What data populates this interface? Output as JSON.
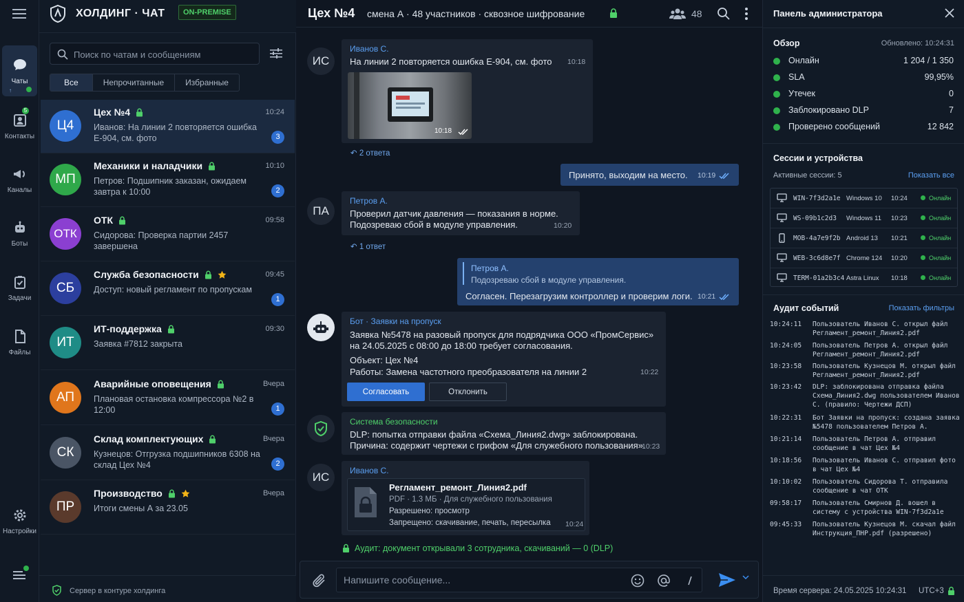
{
  "app": {
    "title": "ХОЛДИНГ · ЧАТ",
    "mode_badge": "ON-PREMISE"
  },
  "rail": {
    "items": [
      {
        "label": "Чаты",
        "icon": "chat-bubble-icon"
      },
      {
        "label": "Контакты",
        "icon": "contacts-icon",
        "badge": "5"
      },
      {
        "label": "Каналы",
        "icon": "megaphone-icon"
      },
      {
        "label": "Боты",
        "icon": "bot-icon"
      },
      {
        "label": "Задачи",
        "icon": "tasks-icon"
      },
      {
        "label": "Файлы",
        "icon": "file-icon"
      },
      {
        "label": "Настройки",
        "icon": "gear-icon"
      }
    ]
  },
  "search": {
    "placeholder": "Поиск по чатам и сообщениям"
  },
  "filters": [
    "Все",
    "Непрочитанные",
    "Избранные"
  ],
  "chats": [
    {
      "initials": "Ц4",
      "color": "#2f6fd1",
      "name": "Цех №4",
      "time": "10:24",
      "preview": "Иванов: На линии 2 повторяется ошибка E-904, см. фото",
      "unread": "3",
      "lock": true,
      "star": false,
      "active": true
    },
    {
      "initials": "МП",
      "color": "#2fa84a",
      "name": "Механики и наладчики",
      "time": "10:10",
      "preview": "Петров: Подшипник заказан, ожидаем завтра к 10:00",
      "unread": "2",
      "lock": true,
      "star": false
    },
    {
      "initials": "ОТК",
      "color": "#8b3fd1",
      "name": "ОТК",
      "time": "09:58",
      "preview": "Сидорова: Проверка партии 2457 завершена",
      "unread": "",
      "lock": true,
      "star": false
    },
    {
      "initials": "СБ",
      "color": "#2c3f9e",
      "name": "Служба безопасности",
      "time": "09:45",
      "preview": "Доступ: новый регламент по пропускам",
      "unread": "1",
      "lock": true,
      "star": true
    },
    {
      "initials": "ИТ",
      "color": "#1f8c86",
      "name": "ИТ-поддержка",
      "time": "09:30",
      "preview": "Заявка #7812 закрыта",
      "unread": "",
      "lock": true,
      "star": false
    },
    {
      "initials": "АП",
      "color": "#e0761c",
      "name": "Аварийные оповещения",
      "time": "Вчера",
      "preview": "Плановая остановка компрессора №2 в 12:00",
      "unread": "1",
      "lock": true,
      "star": false
    },
    {
      "initials": "СК",
      "color": "#4a5565",
      "name": "Склад комплектующих",
      "time": "Вчера",
      "preview": "Кузнецов: Отгрузка подшипников 6308 на склад Цех №4",
      "unread": "2",
      "lock": true,
      "star": false
    },
    {
      "initials": "ПР",
      "color": "#5a3a2c",
      "name": "Производство",
      "time": "Вчера",
      "preview": "Итоги смены А за 23.05",
      "unread": "",
      "lock": true,
      "star": true
    }
  ],
  "list_footer": "Сервер в контуре холдинга",
  "chat": {
    "title": "Цех №4",
    "subtitle": "смена А · 48 участников · сквозное шифрование",
    "members_count": "48",
    "messages": {
      "m1": {
        "avatar": "ИС",
        "author": "Иванов С.",
        "text": "На линии 2 повторяется ошибка E-904, см. фото",
        "time": "10:18",
        "photo_time": "10:18",
        "replies": "2 ответа"
      },
      "m2": {
        "text": "Принято, выходим на место.",
        "time": "10:19"
      },
      "m3": {
        "avatar": "ПА",
        "author": "Петров А.",
        "line1": "Проверил датчик давления — показания в норме.",
        "line2": "Подозреваю сбой в модуле управления.",
        "time": "10:20",
        "replies": "1 ответ"
      },
      "m4": {
        "quote_author": "Петров А.",
        "quote_text": "Подозреваю сбой в модуле управления.",
        "text": "Согласен. Перезагрузим контроллер и проверим логи.",
        "time": "10:21"
      },
      "m5": {
        "author": "Бот · Заявки на пропуск",
        "line1": "Заявка №5478 на разовый пропуск для подрядчика ООО «ПромСервис»",
        "line2": "на 24.05.2025 с 08:00 до 18:00 требует согласования.",
        "line3": "Объект: Цех №4",
        "line4": "Работы: Замена частотного преобразователя на линии 2",
        "time": "10:22",
        "approve": "Согласовать",
        "reject": "Отклонить"
      },
      "m6": {
        "author": "Система безопасности",
        "line1": "DLP: попытка отправки файла «Схема_Линия2.dwg» заблокирована.",
        "line2": "Причина: содержит чертежи с грифом «Для служебного пользования».",
        "time": "10:23"
      },
      "m7": {
        "avatar": "ИС",
        "author": "Иванов С.",
        "file_name": "Регламент_ремонт_Линия2.pdf",
        "file_meta": "PDF · 1.3 МБ · Для служебного пользования",
        "allowed": "Разрешено: просмотр",
        "denied": "Запрещено: скачивание, печать, пересылка",
        "time": "10:24"
      }
    },
    "audit_note": "Аудит: документ открывали 3 сотрудника, скачиваний — 0 (DLP)"
  },
  "composer": {
    "placeholder": "Напишите сообщение..."
  },
  "admin": {
    "title": "Панель администратора",
    "overview": {
      "title": "Обзор",
      "updated": "Обновлено: 10:24:31",
      "rows": [
        {
          "label": "Онлайн",
          "value": "1 204 / 1 350"
        },
        {
          "label": "SLA",
          "value": "99,95%"
        },
        {
          "label": "Утечек",
          "value": "0"
        },
        {
          "label": "Заблокировано DLP",
          "value": "7"
        },
        {
          "label": "Проверено сообщений",
          "value": "12 842"
        }
      ]
    },
    "sessions": {
      "title": "Сессии и устройства",
      "active": "Активные сессии: 5",
      "show_all": "Показать все",
      "rows": [
        {
          "device": "WIN-7f3d2a1e",
          "os": "Windows 10",
          "time": "10:24",
          "status": "Онлайн",
          "icon": "monitor-icon"
        },
        {
          "device": "WS-09b1c2d3",
          "os": "Windows 11",
          "time": "10:23",
          "status": "Онлайн",
          "icon": "monitor-icon"
        },
        {
          "device": "MOB-4a7e9f2b",
          "os": "Android 13",
          "time": "10:21",
          "status": "Онлайн",
          "icon": "phone-icon"
        },
        {
          "device": "WEB-3c6d8e7f",
          "os": "Chrome 124",
          "time": "10:20",
          "status": "Онлайн",
          "icon": "monitor-icon"
        },
        {
          "device": "TERM-01a2b3c4",
          "os": "Astra Linux",
          "time": "10:18",
          "status": "Онлайн",
          "icon": "monitor-icon"
        }
      ]
    },
    "audit": {
      "title": "Аудит событий",
      "filters_link": "Показать фильтры",
      "rows": [
        {
          "time": "10:24:11",
          "text": "Пользователь Иванов С. открыл файл Регламент_ремонт_Линия2.pdf"
        },
        {
          "time": "10:24:05",
          "text": "Пользователь Петров А. открыл файл Регламент_ремонт_Линия2.pdf"
        },
        {
          "time": "10:23:58",
          "text": "Пользователь Кузнецов М. открыл файл Регламент_ремонт_Линия2.pdf"
        },
        {
          "time": "10:23:42",
          "text": "DLP: заблокирована отправка файла Схема_Линия2.dwg пользователем Иванов С. (правило: Чертежи ДСП)"
        },
        {
          "time": "10:22:31",
          "text": "Бот Заявки на пропуск: создана заявка №5478 пользователем Петров А."
        },
        {
          "time": "10:21:14",
          "text": "Пользователь Петров А. отправил сообщение в чат Цех №4"
        },
        {
          "time": "10:18:56",
          "text": "Пользователь Иванов С. отправил фото в чат Цех №4"
        },
        {
          "time": "10:10:02",
          "text": "Пользователь Сидорова Т. отправила сообщение в чат ОТК"
        },
        {
          "time": "09:58:17",
          "text": "Пользователь Смирнов Д. вошел в систему с устройства WIN-7f3d2a1e"
        },
        {
          "time": "09:45:33",
          "text": "Пользователь Кузнецов М. скачал файл Инструкция_ПНР.pdf (разрешено)"
        }
      ]
    },
    "footer": {
      "server_time": "Время сервера: 24.05.2025 10:24:31",
      "tz": "UTC+3"
    }
  }
}
